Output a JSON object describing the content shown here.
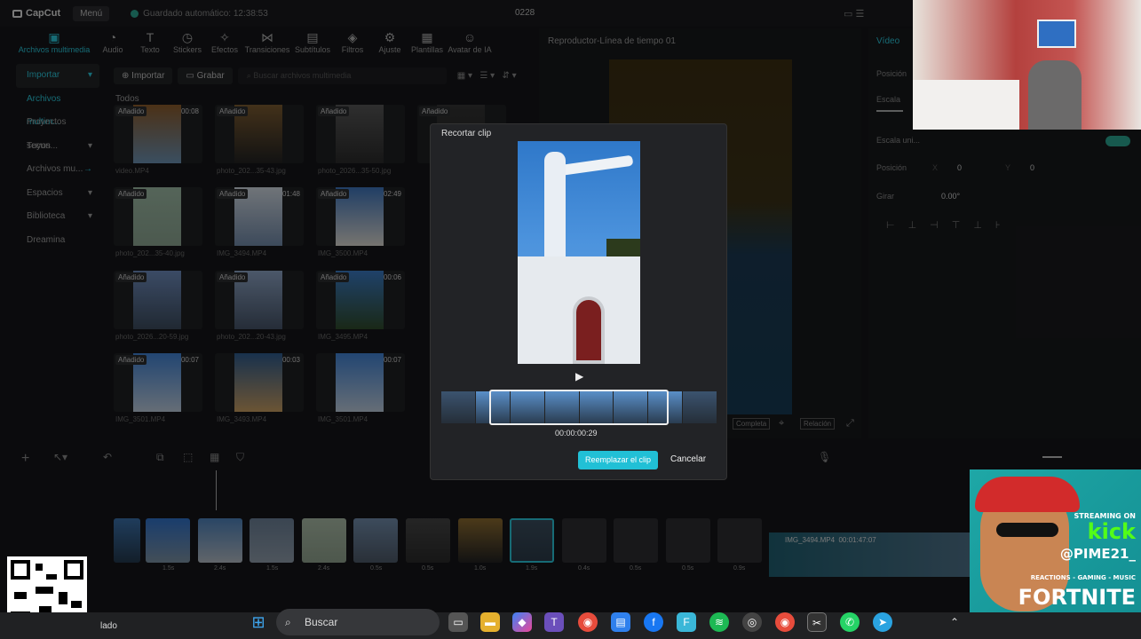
{
  "app": {
    "logo": "CapCut",
    "menu": "Menú",
    "autosave": "Guardado automático: 12:38:53",
    "project_title": "0228"
  },
  "toolbar": [
    "Archivos multimedia",
    "Audio",
    "Texto",
    "Stickers",
    "Efectos",
    "Transiciones",
    "Subtítulos",
    "Filtros",
    "Ajuste",
    "Plantillas",
    "Avatar de IA"
  ],
  "sidebar": [
    {
      "label": "Importar",
      "state": "selected"
    },
    {
      "label": "Archivos multim...",
      "state": "sub"
    },
    {
      "label": "Proyectos secun...",
      "state": ""
    },
    {
      "label": "Tuyos",
      "state": ""
    },
    {
      "label": "Archivos mu...",
      "state": ""
    },
    {
      "label": "Espacios",
      "state": ""
    },
    {
      "label": "Biblioteca",
      "state": ""
    },
    {
      "label": "Dreamina",
      "state": ""
    }
  ],
  "media": {
    "import_button": "Importar",
    "record_button": "Grabar",
    "search_placeholder": "Buscar archivos multimedia",
    "all_label": "Todos"
  },
  "thumbs": [
    {
      "badge": "Añadido",
      "dur": "00:08",
      "name": "video.MP4"
    },
    {
      "badge": "Añadido",
      "dur": "",
      "name": "photo_202...35-43.jpg"
    },
    {
      "badge": "Añadido",
      "dur": "",
      "name": "photo_2026...35-50.jpg"
    },
    {
      "badge": "Añadido",
      "dur": "",
      "name": ""
    },
    {
      "badge": "Añadido",
      "dur": "",
      "name": "photo_202...35-40.jpg"
    },
    {
      "badge": "Añadido",
      "dur": "01:48",
      "name": "IMG_3494.MP4"
    },
    {
      "badge": "Añadido",
      "dur": "02:49",
      "name": "IMG_3500.MP4"
    },
    {
      "badge": "",
      "dur": "",
      "name": ""
    },
    {
      "badge": "Añadido",
      "dur": "",
      "name": "photo_2026...20-59.jpg"
    },
    {
      "badge": "Añadido",
      "dur": "",
      "name": "photo_202...20-43.jpg"
    },
    {
      "badge": "Añadido",
      "dur": "00:06",
      "name": "IMG_3495.MP4"
    },
    {
      "badge": "",
      "dur": "",
      "name": ""
    },
    {
      "badge": "Añadido",
      "dur": "00:07",
      "name": "IMG_3501.MP4"
    },
    {
      "badge": "",
      "dur": "00:03",
      "name": "IMG_3493.MP4"
    },
    {
      "badge": "",
      "dur": "00:07",
      "name": "IMG_3501.MP4"
    }
  ],
  "player": {
    "title": "Reproductor-Línea de tiempo 01",
    "completa": "Completa",
    "relacion": "Relación"
  },
  "right_panel": {
    "tab": "Vídeo",
    "posicion": "Posición",
    "escala": "Escala",
    "escala_uniforme": "Escala uni...",
    "posicion2": "Posición",
    "x_label": "X",
    "x_value": "0",
    "y_label": "Y",
    "y_value": "0",
    "girar": "Girar",
    "girar_value": "0.00°"
  },
  "dialog": {
    "title": "Recortar clip",
    "timecode": "00:00:00:29",
    "replace": "Reemplazar el clip",
    "cancel": "Cancelar"
  },
  "timeline": {
    "clip_name": "IMG_3494.MP4",
    "clip_dur": "00:01:47:07",
    "durations": [
      "1.5s",
      "2.4s",
      "1.5s",
      "2.4s",
      "0.5s",
      "0.5s",
      "1.0s",
      "1.9s",
      "0.4s",
      "0.5s",
      "0.5s",
      "0.9s"
    ]
  },
  "taskbar": {
    "search": "Buscar",
    "lado": "lado"
  },
  "promo": {
    "streaming": "STREAMING ON",
    "kick": "kick",
    "handle": "@PIME21_",
    "tags": "REACTIONS - GAMING - MUSIC",
    "game": "FORTNITE"
  }
}
